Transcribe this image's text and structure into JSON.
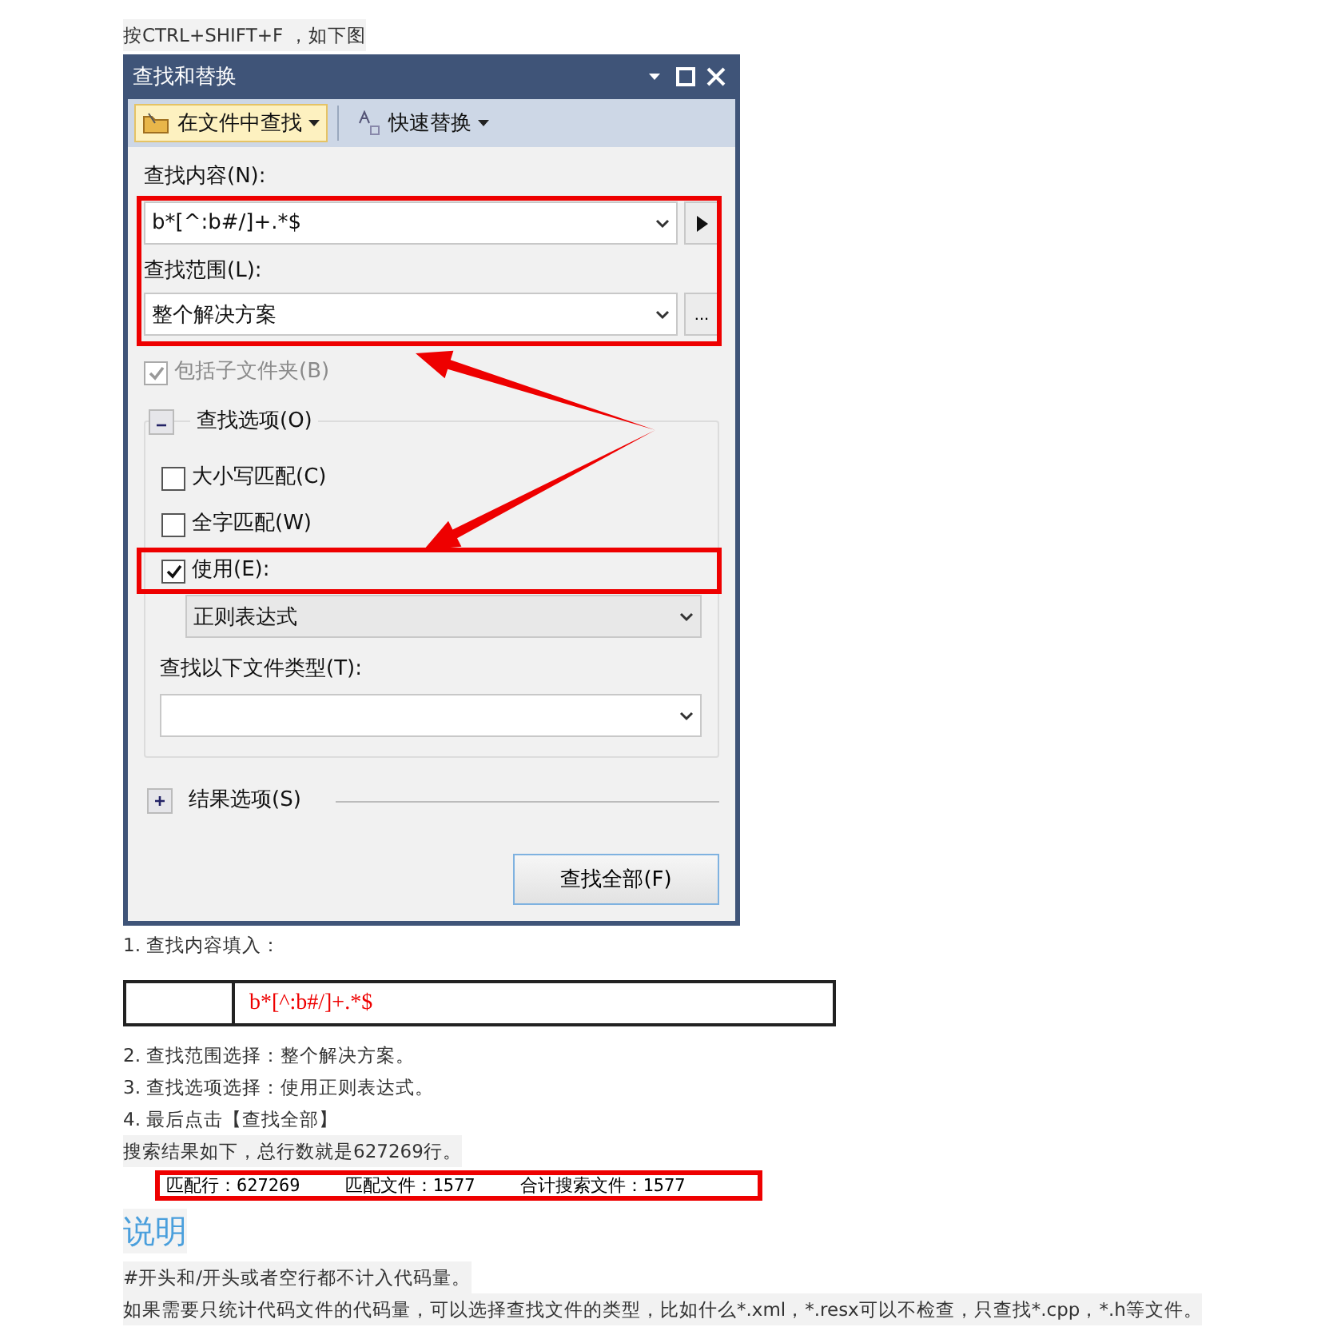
{
  "intro": "按CTRL+SHIFT+F ，如下图",
  "dialog": {
    "title": "查找和替换",
    "tabs": [
      {
        "label": "在文件中查找",
        "selected": true
      },
      {
        "label": "快速替换",
        "selected": false
      }
    ],
    "find_label": "查找内容(N):",
    "find_value": "b*[^:b#/]+.*$",
    "scope_label": "查找范围(L):",
    "scope_value": "整个解决方案",
    "scope_button": "...",
    "include_subfolders": {
      "label": "包括子文件夹(B)",
      "checked": true,
      "disabled": true
    },
    "find_options": {
      "label": "查找选项(O)",
      "expanded": true,
      "options": [
        {
          "label": "大小写匹配(C)",
          "checked": false
        },
        {
          "label": "全字匹配(W)",
          "checked": false
        },
        {
          "label": "使用(E):",
          "checked": true
        }
      ],
      "use_value": "正则表达式",
      "filetype_label": "查找以下文件类型(T):"
    },
    "result_options": {
      "label": "结果选项(S)",
      "expanded": false
    },
    "find_all_button": "查找全部(F)"
  },
  "step_1": "1. 查找内容填入：",
  "code": "b*[^:b#/]+.*$",
  "steps": [
    "2. 查找范围选择：整个解决方案。",
    "3. 查找选项选择：使用正则表达式。",
    "4. 最后点击【查找全部】"
  ],
  "result_text": "搜索结果如下，总行数就是627269行。",
  "result_bar": [
    "匹配行：627269",
    "匹配文件：1577",
    "合计搜索文件：1577"
  ],
  "heading": "说明",
  "notes": [
    "#开头和/开头或者空行都不计入代码量。",
    "如果需要只统计代码文件的代码量，可以选择查找文件的类型，比如什么*.xml，*.resx可以不检查，只查找*.cpp，*.h等文件。"
  ]
}
